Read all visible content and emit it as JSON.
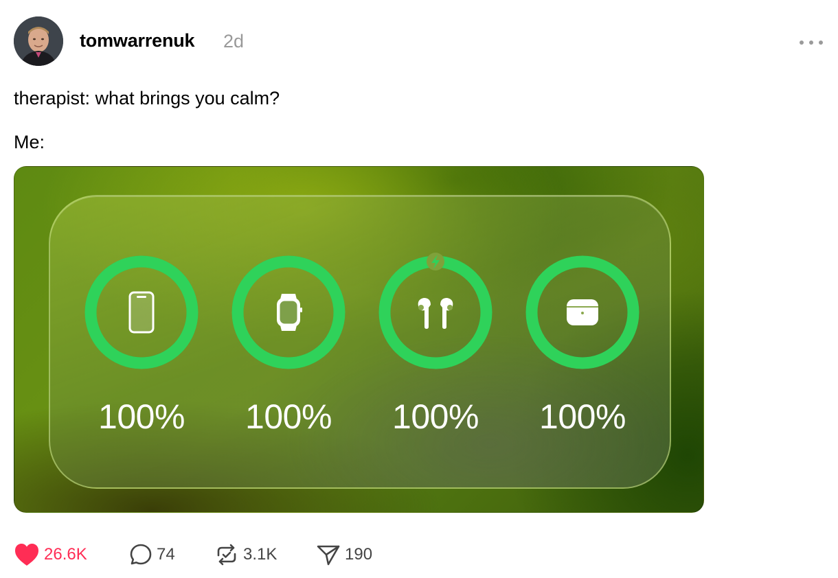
{
  "post": {
    "username": "tomwarrenuk",
    "time_ago": "2d",
    "text_lines": [
      "therapist: what brings you calm?",
      "Me:"
    ]
  },
  "widget": {
    "devices": [
      {
        "icon": "phone-icon",
        "percent": "100%",
        "level": 1.0,
        "charging": false
      },
      {
        "icon": "watch-icon",
        "percent": "100%",
        "level": 1.0,
        "charging": false
      },
      {
        "icon": "airpods-icon",
        "percent": "100%",
        "level": 1.0,
        "charging": true
      },
      {
        "icon": "airpods-case-icon",
        "percent": "100%",
        "level": 1.0,
        "charging": false
      }
    ],
    "ring_color": "#2fd25a"
  },
  "actions": {
    "likes": "26.6K",
    "replies": "74",
    "reposts": "3.1K",
    "shares": "190",
    "like_color": "#ff2d55"
  }
}
